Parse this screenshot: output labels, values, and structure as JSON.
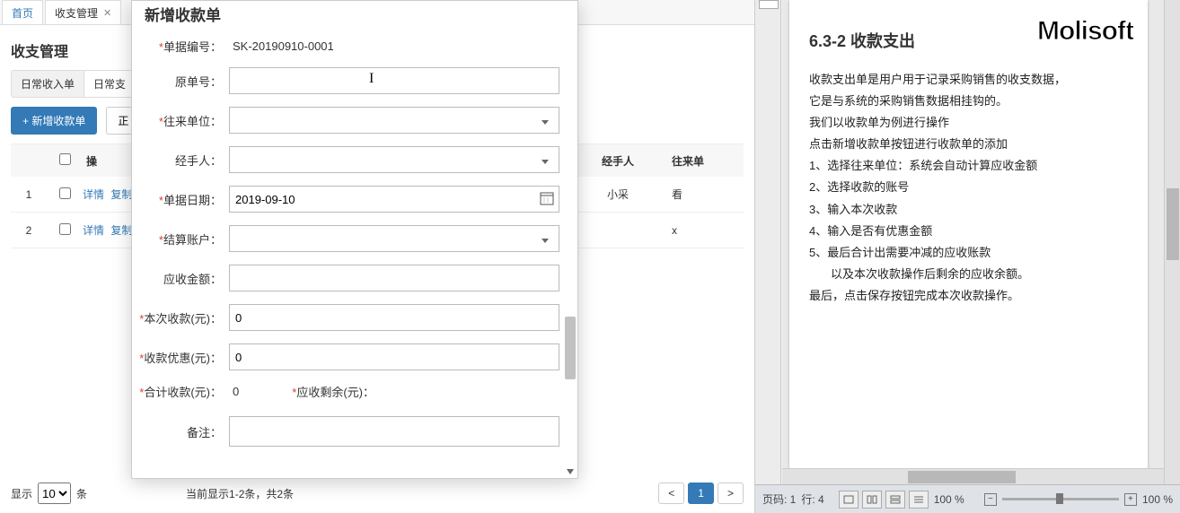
{
  "tabs": [
    {
      "label": "首页",
      "active": true,
      "closable": false
    },
    {
      "label": "收支管理",
      "active": false,
      "closable": true
    }
  ],
  "page_title": "收支管理",
  "subtabs": [
    "日常收入单",
    "日常支"
  ],
  "toolbar": {
    "add_button": "+ 新增收款单",
    "btn2": "正"
  },
  "table": {
    "head_op": "操",
    "head_handler": "经手人",
    "head_partner": "往来单",
    "rows": [
      {
        "idx": "1",
        "op1": "详情",
        "op2": "复制",
        "handler": "小采",
        "partner": "看"
      },
      {
        "idx": "2",
        "op1": "详情",
        "op2": "复制",
        "handler": "",
        "partner": "х"
      }
    ]
  },
  "footer": {
    "show_label": "显示",
    "per_page": "10",
    "unit": "条",
    "info": "当前显示1-2条，共2条",
    "prev": "<",
    "page1": "1",
    "next": ">"
  },
  "modal": {
    "title": "新增收款单",
    "labels": {
      "doc_no": "单据编号：",
      "orig_no": "原单号：",
      "partner": "往来单位：",
      "handler": "经手人：",
      "doc_date": "单据日期：",
      "account": "结算账户：",
      "receivable": "应收金额：",
      "this_receipt": "本次收款(元)：",
      "discount": "收款优惠(元)：",
      "total_receipt": "合计收款(元)：",
      "remaining": "应收剩余(元)：",
      "remark": "备注："
    },
    "values": {
      "doc_no": "SK-20190910-0001",
      "orig_no": "",
      "doc_date": "2019-09-10",
      "this_receipt": "0",
      "discount": "0",
      "total_receipt": "0",
      "remaining": ""
    }
  },
  "doc": {
    "watermark": "Molisoft",
    "heading": "6.3-2 收款支出",
    "lines": [
      "收款支出单是用户用于记录采购销售的收支数据，",
      "它是与系统的采购销售数据相挂钩的。",
      "我们以收款单为例进行操作",
      "点击新增收款单按钮进行收款单的添加",
      "1、选择往来单位：系统会自动计算应收金额",
      "2、选择收款的账号",
      "3、输入本次收款",
      "4、输入是否有优惠金额",
      "5、最后合计出需要冲减的应收账款",
      "以及本次收款操作后剩余的应收余额。",
      "最后，点击保存按钮完成本次收款操作。"
    ],
    "indent_lines": [
      9
    ]
  },
  "status": {
    "page": "页码: 1",
    "line": "行: 4",
    "zoom_left": "100 %",
    "minus": "−",
    "plus": "+",
    "zoom_right": "100 %"
  }
}
